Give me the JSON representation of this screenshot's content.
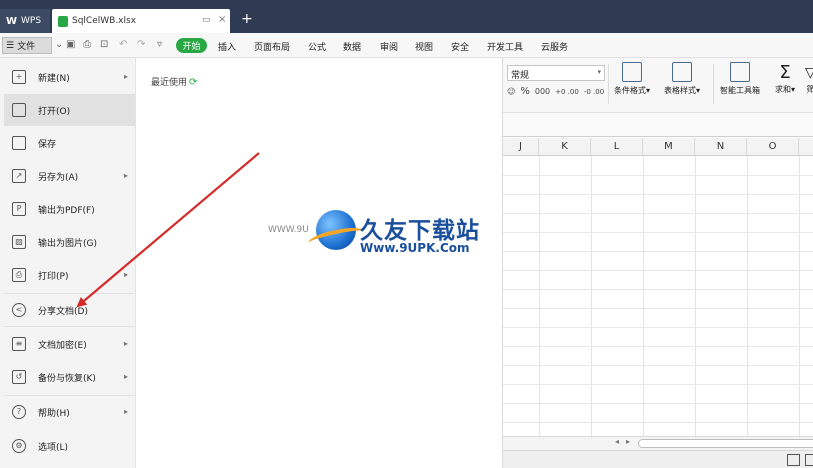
{
  "tabs": {
    "wps_label": "WPS",
    "file_name": "SqlCelWB.xlsx"
  },
  "menubar": {
    "file_label": "文件",
    "items": [
      "开始",
      "插入",
      "页面布局",
      "公式",
      "数据",
      "审阅",
      "视图",
      "安全",
      "开发工具",
      "云服务"
    ]
  },
  "filemenu": {
    "items": [
      {
        "label": "新建(N)",
        "icon": "new-file-icon",
        "submenu": true
      },
      {
        "label": "打开(O)",
        "icon": "folder-open-icon",
        "submenu": false,
        "active": true
      },
      {
        "label": "保存",
        "icon": "save-icon",
        "submenu": false
      },
      {
        "label": "另存为(A)",
        "icon": "save-as-icon",
        "submenu": true
      },
      {
        "label": "输出为PDF(F)",
        "icon": "pdf-export-icon",
        "submenu": false
      },
      {
        "label": "输出为图片(G)",
        "icon": "image-export-icon",
        "submenu": false
      },
      {
        "label": "打印(P)",
        "icon": "print-icon",
        "submenu": true
      },
      {
        "label": "分享文档(D)",
        "icon": "share-icon",
        "submenu": false
      },
      {
        "label": "文档加密(E)",
        "icon": "encrypt-icon",
        "submenu": true
      },
      {
        "label": "备份与恢复(K)",
        "icon": "backup-icon",
        "submenu": true
      },
      {
        "label": "帮助(H)",
        "icon": "help-icon",
        "submenu": true
      },
      {
        "label": "选项(L)",
        "icon": "settings-icon",
        "submenu": false
      }
    ]
  },
  "recent": {
    "title": "最近使用"
  },
  "ribbon": {
    "number_format": "常规",
    "format_symbols": [
      "☺",
      "%",
      "000",
      "+0 .00",
      "-0 .00"
    ],
    "conditional_format": "条件格式",
    "table_style": "表格样式",
    "smart_toolbox": "智能工具箱",
    "sum": "求和",
    "more": "筛"
  },
  "grid": {
    "columns": [
      "J",
      "K",
      "L",
      "M",
      "N",
      "O"
    ]
  },
  "watermark": {
    "brand": "久友下载站",
    "url": "Www.9UPK.Com",
    "left_text": "WWW.9U"
  },
  "colors": {
    "titlebar": "#2f3b52",
    "start_tab": "#27a845",
    "arrow": "#d42a2a"
  }
}
